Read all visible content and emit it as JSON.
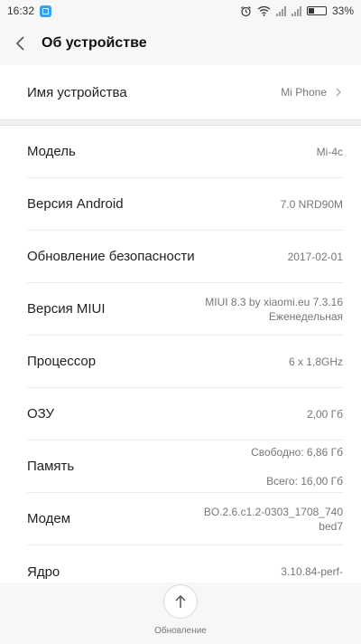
{
  "status": {
    "time": "16:32",
    "battery": "33%",
    "battery_level": 0.33
  },
  "header": {
    "title": "Об устройстве"
  },
  "device": {
    "label": "Имя устройства",
    "value": "Mi Phone"
  },
  "info": [
    {
      "label": "Модель",
      "value": "Mi-4c"
    },
    {
      "label": "Версия Android",
      "value": "7.0 NRD90M"
    },
    {
      "label": "Обновление безопасности",
      "value": "2017-02-01"
    },
    {
      "label": "Версия MIUI",
      "value_line1": "MIUI 8.3 by xiaomi.eu 7.3.16",
      "value_line2": "Еженедельная"
    },
    {
      "label": "Процессор",
      "value": "6 x 1,8GHz"
    },
    {
      "label": "ОЗУ",
      "value": "2,00 Гб"
    },
    {
      "label": "Память",
      "value_line1": "Свободно: 6,86 Гб",
      "value_line2": "Всего: 16,00 Гб"
    },
    {
      "label": "Модем",
      "value_line1": "BO.2.6.c1.2-0303_1708_740",
      "value_line2": "bed7"
    },
    {
      "label": "Ядро",
      "value_line1": "3.10.84-perf-"
    }
  ],
  "bottom": {
    "update_label": "Обновление"
  },
  "colors": {
    "accent": "#3aa0e8",
    "background": "#f7f7f7",
    "card": "#ffffff"
  }
}
